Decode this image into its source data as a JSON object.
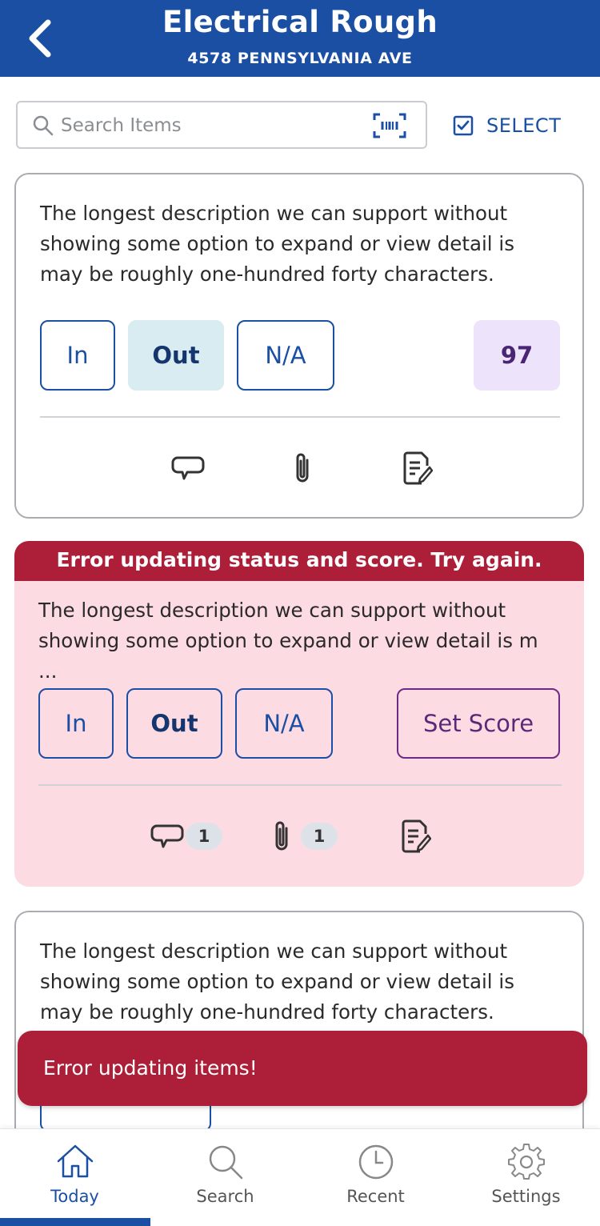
{
  "header": {
    "title": "Electrical Rough",
    "subtitle": "4578 PENNSYLVANIA AVE"
  },
  "search": {
    "placeholder": "Search Items",
    "value": ""
  },
  "select_label": "SELECT",
  "items": [
    {
      "description": "The longest description we can support without showing some option to expand or view detail is may be roughly one-hundred forty characters.",
      "status_in": "In",
      "status_out": "Out",
      "status_na": "N/A",
      "selected_status": "Out",
      "score": "97"
    },
    {
      "error": "Error updating status and score. Try again.",
      "description": "The longest description we can support without showing some option to expand or view detail is m ...",
      "status_in": "In",
      "status_out": "Out",
      "status_na": "N/A",
      "score_label": "Set Score",
      "comment_count": "1",
      "attachment_count": "1"
    },
    {
      "description": "The longest description we can support without showing some option to expand or view detail is may be roughly one-hundred forty characters."
    }
  ],
  "toast": {
    "message": "Error updating items!"
  },
  "tabs": [
    {
      "label": "Today",
      "icon": "home-icon",
      "active": true
    },
    {
      "label": "Search",
      "icon": "search-icon",
      "active": false
    },
    {
      "label": "Recent",
      "icon": "clock-icon",
      "active": false
    },
    {
      "label": "Settings",
      "icon": "gear-icon",
      "active": false
    }
  ],
  "colors": {
    "brand_blue": "#1a4fa3",
    "error_red": "#ad1e38",
    "error_card_bg": "#fddbe3",
    "score_bg": "#ede3fa",
    "selected_status_bg": "#d8ecf2"
  }
}
